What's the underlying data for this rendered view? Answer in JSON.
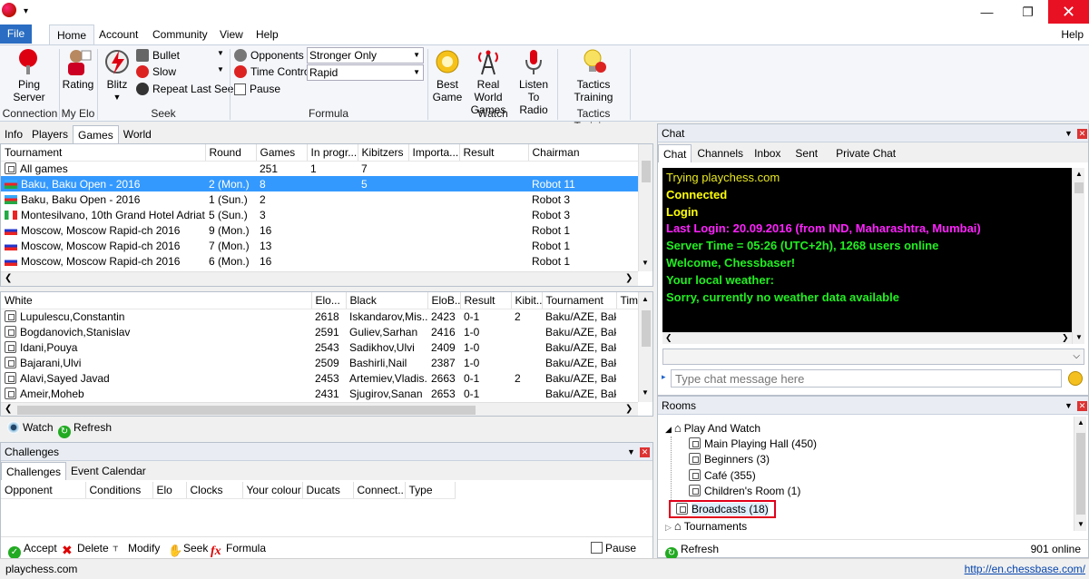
{
  "ribbon": {
    "file": "File",
    "tabs": [
      "Home",
      "Account",
      "Community",
      "View",
      "Help"
    ],
    "help_right": "Help",
    "groups": {
      "connection": {
        "label": "Connection",
        "ping_l1": "Ping",
        "ping_l2": "Server"
      },
      "myelo": {
        "label": "My Elo",
        "rating": "Rating"
      },
      "seek": {
        "label": "Seek",
        "blitz": "Blitz",
        "bullet": "Bullet",
        "slow": "Slow",
        "repeat": "Repeat Last Seek"
      },
      "formula": {
        "label": "Formula",
        "opponents": "Opponents",
        "time_control": "Time Control",
        "pause": "Pause",
        "opponents_value": "Stronger Only",
        "time_value": "Rapid"
      },
      "watch": {
        "label": "Watch",
        "best_l1": "Best",
        "best_l2": "Game",
        "real_l1": "Real World",
        "real_l2": "Games",
        "listen_l1": "Listen",
        "listen_l2": "To Radio"
      },
      "tactics": {
        "label": "Tactics Training",
        "btn_l1": "Tactics",
        "btn_l2": "Training"
      }
    }
  },
  "left_tabs": [
    "Info",
    "Players",
    "Games",
    "World"
  ],
  "tournaments": {
    "columns": [
      "Tournament",
      "Round",
      "Games",
      "In progr...",
      "Kibitzers",
      "Importa...",
      "Result",
      "Chairman"
    ],
    "rows": [
      {
        "tournament": "All games",
        "round": "",
        "games": "251",
        "inprog": "1",
        "kib": "7",
        "imp": "",
        "result": "",
        "chair": "",
        "flag": "none"
      },
      {
        "tournament": "Baku, Baku Open - 2016",
        "round": "2 (Mon.)",
        "games": "8",
        "inprog": "",
        "kib": "5",
        "imp": "",
        "result": "",
        "chair": "Robot 11",
        "flag": "az"
      },
      {
        "tournament": "Baku, Baku Open - 2016",
        "round": "1 (Sun.)",
        "games": "2",
        "inprog": "",
        "kib": "",
        "imp": "",
        "result": "",
        "chair": "Robot 3",
        "flag": "az"
      },
      {
        "tournament": "Montesilvano, 10th Grand Hotel Adriati...",
        "round": "5 (Sun.)",
        "games": "3",
        "inprog": "",
        "kib": "",
        "imp": "",
        "result": "",
        "chair": "Robot 3",
        "flag": "it"
      },
      {
        "tournament": "Moscow, Moscow Rapid-ch 2016",
        "round": "9 (Mon.)",
        "games": "16",
        "inprog": "",
        "kib": "",
        "imp": "",
        "result": "",
        "chair": "Robot 1",
        "flag": "ru"
      },
      {
        "tournament": "Moscow, Moscow Rapid-ch 2016",
        "round": "7 (Mon.)",
        "games": "13",
        "inprog": "",
        "kib": "",
        "imp": "",
        "result": "",
        "chair": "Robot 1",
        "flag": "ru"
      },
      {
        "tournament": "Moscow, Moscow Rapid-ch 2016",
        "round": "6 (Mon.)",
        "games": "16",
        "inprog": "",
        "kib": "",
        "imp": "",
        "result": "",
        "chair": "Robot 1",
        "flag": "ru"
      }
    ]
  },
  "games": {
    "columns": [
      "White",
      "Elo...",
      "Black",
      "EloB...",
      "Result",
      "Kibit...",
      "Tournament",
      "Tim"
    ],
    "rows": [
      {
        "white": "Lupulescu,Constantin",
        "elo": "2618",
        "black": "Iskandarov,Mis...",
        "elob": "2423",
        "result": "0-1",
        "kib": "2",
        "tour": "Baku/AZE, Bak..."
      },
      {
        "white": "Bogdanovich,Stanislav",
        "elo": "2591",
        "black": "Guliev,Sarhan",
        "elob": "2416",
        "result": "1-0",
        "kib": "",
        "tour": "Baku/AZE, Bak..."
      },
      {
        "white": "Idani,Pouya",
        "elo": "2543",
        "black": "Sadikhov,Ulvi",
        "elob": "2409",
        "result": "1-0",
        "kib": "",
        "tour": "Baku/AZE, Bak..."
      },
      {
        "white": "Bajarani,Ulvi",
        "elo": "2509",
        "black": "Bashirli,Nail",
        "elob": "2387",
        "result": "1-0",
        "kib": "",
        "tour": "Baku/AZE, Bak..."
      },
      {
        "white": "Alavi,Sayed Javad",
        "elo": "2453",
        "black": "Artemiev,Vladis...",
        "elob": "2663",
        "result": "0-1",
        "kib": "2",
        "tour": "Baku/AZE, Bak..."
      },
      {
        "white": "Ameir,Moheb",
        "elo": "2431",
        "black": "Sjugirov,Sanan",
        "elob": "2653",
        "result": "0-1",
        "kib": "",
        "tour": "Baku/AZE, Bak..."
      }
    ],
    "watch": "Watch",
    "refresh": "Refresh"
  },
  "challenges": {
    "title": "Challenges",
    "tabs": [
      "Challenges",
      "Event Calendar"
    ],
    "columns": [
      "Opponent",
      "Conditions",
      "Elo",
      "Clocks",
      "Your colour",
      "Ducats",
      "Connect...",
      "Type"
    ],
    "accept": "Accept",
    "delete": "Delete",
    "modify": "Modify",
    "seek": "Seek",
    "formula": "Formula",
    "pause": "Pause"
  },
  "chat": {
    "title": "Chat",
    "tabs": [
      "Chat",
      "Channels",
      "Inbox",
      "Sent",
      "Private Chat"
    ],
    "lines": [
      {
        "text": "Trying playchess.com",
        "color": "#e8e820",
        "bold": false
      },
      {
        "text": "Connected",
        "color": "#ffff00",
        "bold": true
      },
      {
        "text": "Login",
        "color": "#ffff00",
        "bold": true
      },
      {
        "text": "Last Login: 20.09.2016 (from IND, Maharashtra, Mumbai)",
        "color": "#ff22ff",
        "bold": true
      },
      {
        "text": "Server Time = 05:26 (UTC+2h), 1268 users online",
        "color": "#22ee22",
        "bold": true
      },
      {
        "text": "Welcome, Chessbaser!",
        "color": "#22ee22",
        "bold": true
      },
      {
        "text": "Your local weather:",
        "color": "#22ee22",
        "bold": true
      },
      {
        "text": "Sorry, currently no weather data available",
        "color": "#22ee22",
        "bold": true
      }
    ],
    "input_placeholder": "Type chat message here"
  },
  "rooms": {
    "title": "Rooms",
    "play_and_watch": "Play And Watch",
    "items": [
      "Main Playing Hall  (450)",
      "Beginners  (3)",
      "Café  (355)",
      "Children's Room  (1)"
    ],
    "broadcasts": "Broadcasts  (18)",
    "tournaments": "Tournaments",
    "refresh": "Refresh",
    "online": "901 online"
  },
  "status": {
    "left": "playchess.com",
    "right": "http://en.chessbase.com/"
  },
  "colors": {
    "selection": "#3399ff",
    "highlight_box": "#e0001b",
    "close_button": "#e81123"
  }
}
